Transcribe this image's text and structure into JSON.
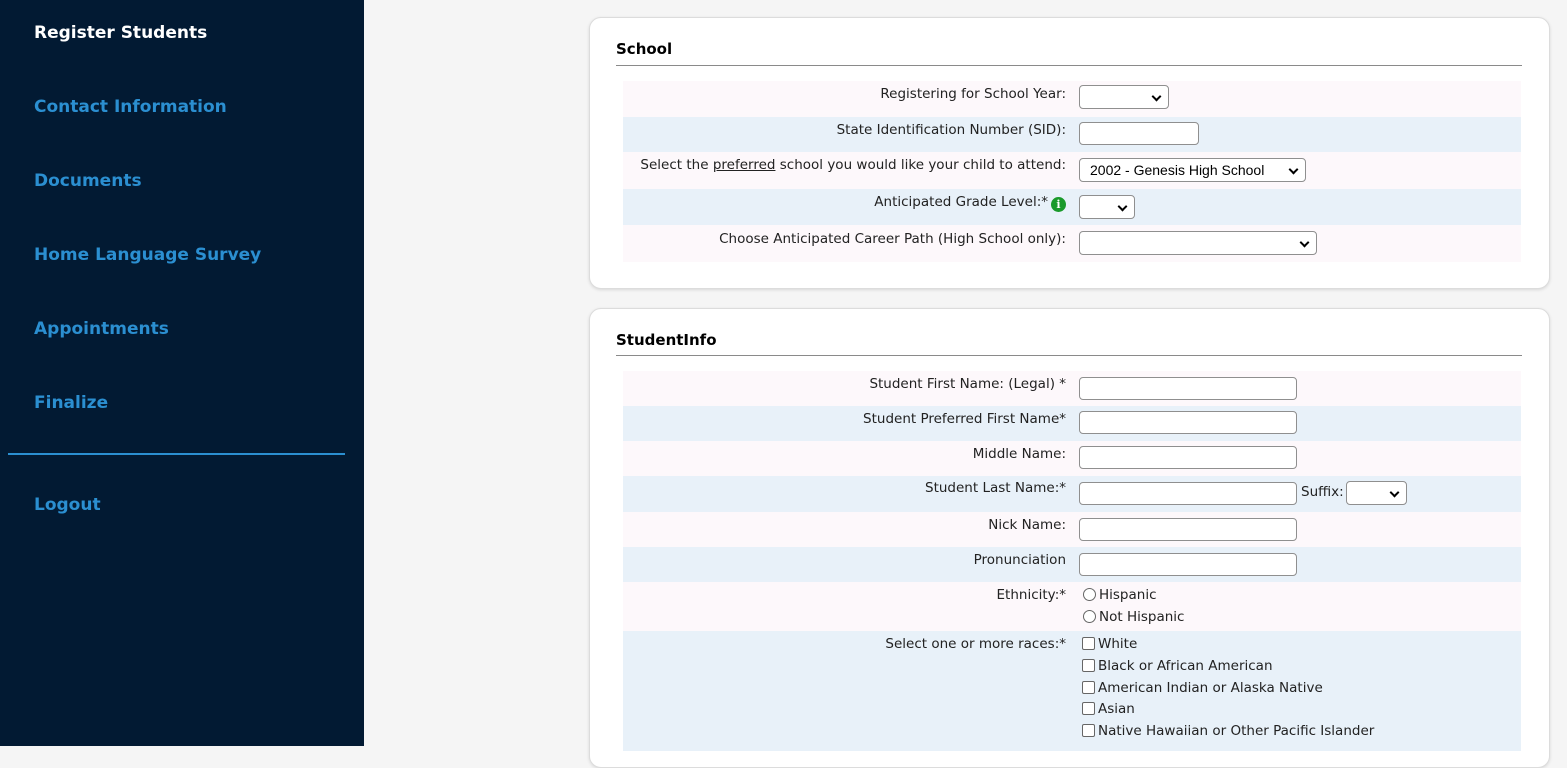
{
  "sidebar": {
    "items": [
      {
        "label": "Register Students",
        "active": true
      },
      {
        "label": "Contact Information"
      },
      {
        "label": "Documents"
      },
      {
        "label": "Home Language Survey"
      },
      {
        "label": "Appointments"
      },
      {
        "label": "Finalize"
      }
    ],
    "logout_label": "Logout"
  },
  "school": {
    "title": "School",
    "school_year_label": "Registering for School Year:",
    "school_year_value": "",
    "sid_label": "State Identification Number (SID):",
    "sid_value": "",
    "preferred_label_prefix": "Select the ",
    "preferred_label_underlined": "preferred",
    "preferred_label_suffix": " school you would like your child to attend:",
    "preferred_school_value": "2002 - Genesis High School",
    "grade_label": "Anticipated Grade Level:*",
    "grade_info_icon": "i",
    "grade_value": "",
    "career_label": "Choose Anticipated Career Path (High School only):",
    "career_value": ""
  },
  "student_info": {
    "title": "StudentInfo",
    "first_name_label": "Student First Name: (Legal) *",
    "first_name_value": "",
    "preferred_first_label": "Student Preferred First Name*",
    "preferred_first_value": "",
    "middle_label": "Middle Name:",
    "middle_value": "",
    "last_name_label": "Student Last Name:*",
    "last_name_value": "",
    "suffix_label": "Suffix:",
    "suffix_value": "",
    "nick_label": "Nick Name:",
    "nick_value": "",
    "pronunciation_label": "Pronunciation",
    "pronunciation_value": "",
    "ethnicity_label": "Ethnicity:*",
    "ethnicity_options": [
      "Hispanic",
      "Not Hispanic"
    ],
    "races_label": "Select one or more races:*",
    "race_options": [
      "White",
      "Black or African American",
      "American Indian or Alaska Native",
      "Asian",
      "Native Hawaiian or Other Pacific Islander"
    ]
  },
  "colors": {
    "sidebar_bg": "#021a33",
    "nav_link": "#2b8fd1",
    "nav_active": "#ffffff",
    "row_odd": "#fdf8fb",
    "row_even": "#e8f1f9",
    "info_icon": "#1a9a2b"
  }
}
